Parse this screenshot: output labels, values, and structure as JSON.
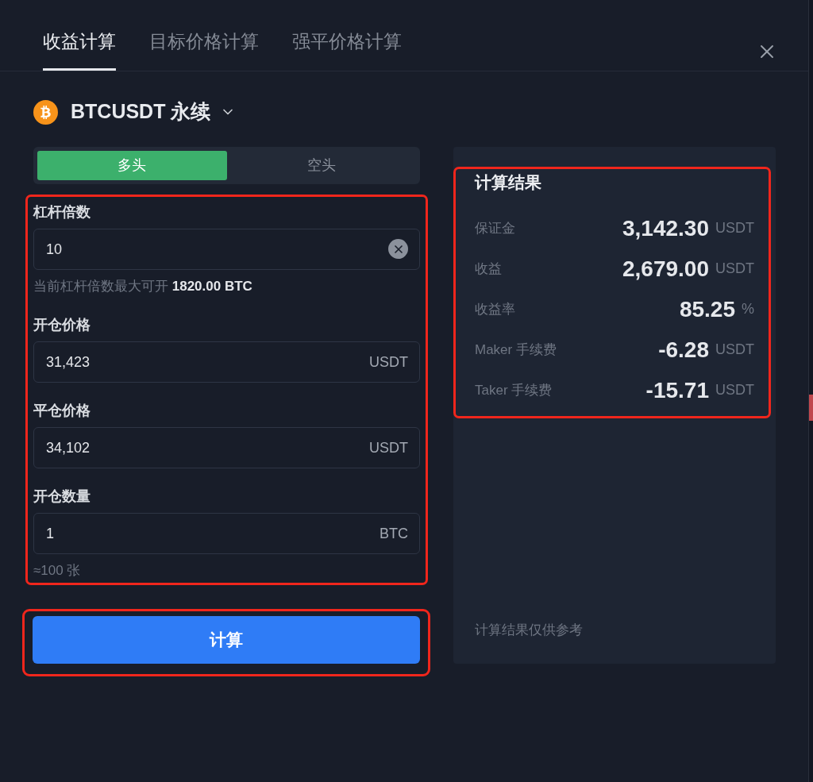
{
  "tabs": [
    {
      "label": "收益计算",
      "selected": true
    },
    {
      "label": "目标价格计算",
      "selected": false
    },
    {
      "label": "强平价格计算",
      "selected": false
    }
  ],
  "symbol": {
    "name": "BTCUSDT 永续"
  },
  "direction": [
    {
      "label": "多头",
      "selected": true
    },
    {
      "label": "空头",
      "selected": false
    }
  ],
  "form": {
    "highlighted": true,
    "fields": [
      {
        "label": "杠杆倍数",
        "value": "10",
        "clearable": true,
        "hint": "当前杠杆倍数最大可开 **1820.00 BTC**"
      },
      {
        "label": "开仓价格",
        "value": "31,423",
        "unit": "USDT"
      },
      {
        "label": "平仓价格",
        "value": "34,102",
        "unit": "USDT"
      },
      {
        "label": "开仓数量",
        "value": "1",
        "unit": "BTC",
        "hint": "≈100 张"
      }
    ]
  },
  "calculate_button": {
    "label": "计算",
    "highlighted": true
  },
  "results": {
    "title": "计算结果",
    "highlighted": true,
    "rows": [
      {
        "label": "保证金",
        "value": "3,142.30",
        "unit": "USDT"
      },
      {
        "label": "收益",
        "value": "2,679.00",
        "unit": "USDT"
      },
      {
        "label": "收益率",
        "value": "85.25",
        "unit": "%"
      },
      {
        "label": "Maker 手续费",
        "value": "-6.28",
        "unit": "USDT"
      },
      {
        "label": "Taker 手续费",
        "value": "-15.71",
        "unit": "USDT"
      }
    ],
    "footnote": "计算结果仅供参考"
  }
}
